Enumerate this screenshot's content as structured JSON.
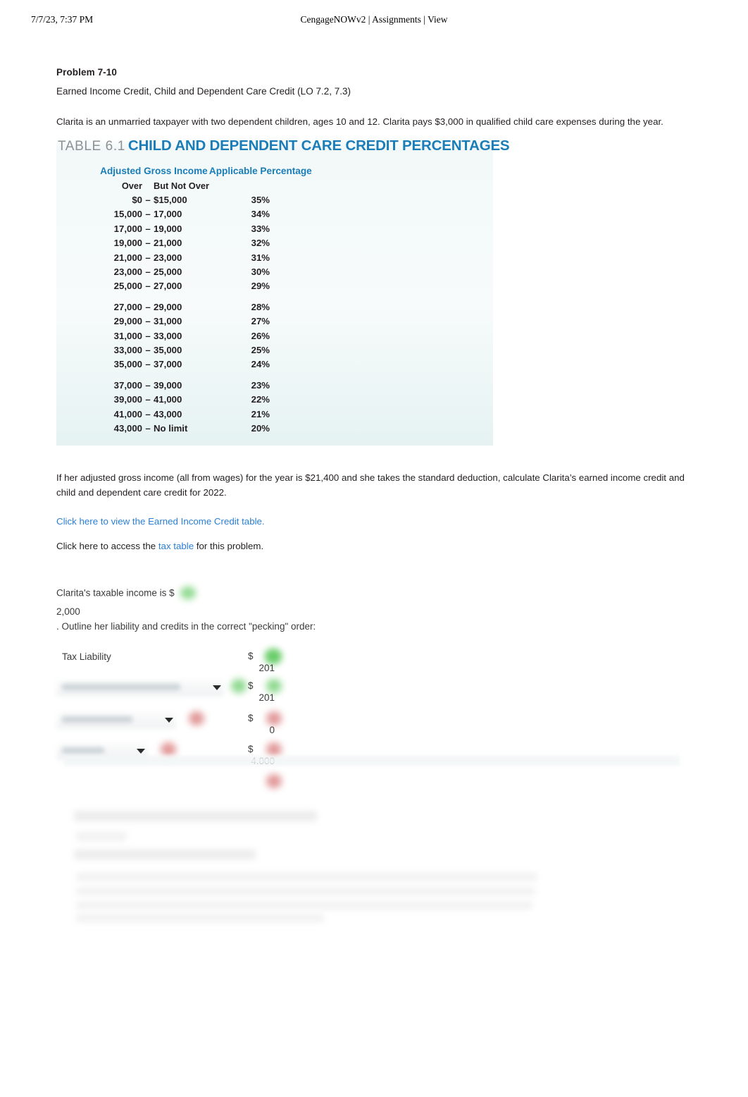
{
  "print_header": {
    "date": "7/7/23, 7:37 PM",
    "title": "CengageNOWv2 | Assignments | View"
  },
  "problem": {
    "number": "Problem 7-10",
    "topic": "Earned Income Credit, Child and Dependent Care Credit (LO 7.2, 7.3)",
    "intro": "Clarita is an unmarried taxpayer with two dependent children, ages 10 and 12. Clarita pays $3,000 in qualified child care expenses during the year.",
    "question": "If her adjusted gross income (all from wages) for the year is $21,400 and she takes the standard deduction, calculate Clarita’s earned income credit and child and dependent care credit for 2022.",
    "link_eic": "Click here to view the Earned Income Credit table.",
    "link_tax_prefix": "Click here to access the",
    "link_tax": "tax table",
    "link_tax_suffix": "for this problem."
  },
  "table": {
    "caption_number": "TABLE 6.1",
    "caption_title": "CHILD AND DEPENDENT CARE CREDIT PERCENTAGES",
    "header_agi": "Adjusted Gross Income",
    "header_pct": "Applicable Percentage",
    "sub_over": "Over",
    "sub_dash": "–",
    "sub_but_not_over": "But Not Over",
    "rows": [
      {
        "over": "$0",
        "dash": "–",
        "but_not_over": "$15,000",
        "pct": "35%",
        "gap": false
      },
      {
        "over": "15,000",
        "dash": "–",
        "but_not_over": "17,000",
        "pct": "34%",
        "gap": false
      },
      {
        "over": "17,000",
        "dash": "–",
        "but_not_over": "19,000",
        "pct": "33%",
        "gap": false
      },
      {
        "over": "19,000",
        "dash": "–",
        "but_not_over": "21,000",
        "pct": "32%",
        "gap": false
      },
      {
        "over": "21,000",
        "dash": "–",
        "but_not_over": "23,000",
        "pct": "31%",
        "gap": false
      },
      {
        "over": "23,000",
        "dash": "–",
        "but_not_over": "25,000",
        "pct": "30%",
        "gap": false
      },
      {
        "over": "25,000",
        "dash": "–",
        "but_not_over": "27,000",
        "pct": "29%",
        "gap": false
      },
      {
        "over": "27,000",
        "dash": "–",
        "but_not_over": "29,000",
        "pct": "28%",
        "gap": true
      },
      {
        "over": "29,000",
        "dash": "–",
        "but_not_over": "31,000",
        "pct": "27%",
        "gap": false
      },
      {
        "over": "31,000",
        "dash": "–",
        "but_not_over": "33,000",
        "pct": "26%",
        "gap": false
      },
      {
        "over": "33,000",
        "dash": "–",
        "but_not_over": "35,000",
        "pct": "25%",
        "gap": false
      },
      {
        "over": "35,000",
        "dash": "–",
        "but_not_over": "37,000",
        "pct": "24%",
        "gap": false
      },
      {
        "over": "37,000",
        "dash": "–",
        "but_not_over": "39,000",
        "pct": "23%",
        "gap": true
      },
      {
        "over": "39,000",
        "dash": "–",
        "but_not_over": "41,000",
        "pct": "22%",
        "gap": false
      },
      {
        "over": "41,000",
        "dash": "–",
        "but_not_over": "43,000",
        "pct": "21%",
        "gap": false
      },
      {
        "over": "43,000",
        "dash": "–",
        "but_not_over": "No limit",
        "pct": "20%",
        "gap": false
      }
    ]
  },
  "answer": {
    "taxable_income_prompt": "Clarita's taxable income is $",
    "taxable_income_value": "2,000",
    "outline_prompt": ". Outline her liability and credits in the correct \"pecking\" order:",
    "rows": [
      {
        "label": "Tax Liability",
        "dropdown": false,
        "dollar": "$",
        "amount": "201",
        "status": "correct"
      },
      {
        "label": "",
        "dropdown": true,
        "dollar": "$",
        "amount": "201",
        "status": "correct"
      },
      {
        "label": "",
        "dropdown": true,
        "dollar": "$",
        "amount": "0",
        "status": "incorrect"
      },
      {
        "label": "",
        "dropdown": true,
        "dollar": "$",
        "amount": "4.000",
        "status": "incorrect"
      }
    ]
  },
  "colors": {
    "accent_blue": "#1a7db8",
    "link_blue": "#2a7fd4",
    "caption_gray": "#8c9194",
    "status_correct": "#49c24a",
    "status_incorrect": "#d05a5a",
    "table_band": "#e8f3f3"
  }
}
